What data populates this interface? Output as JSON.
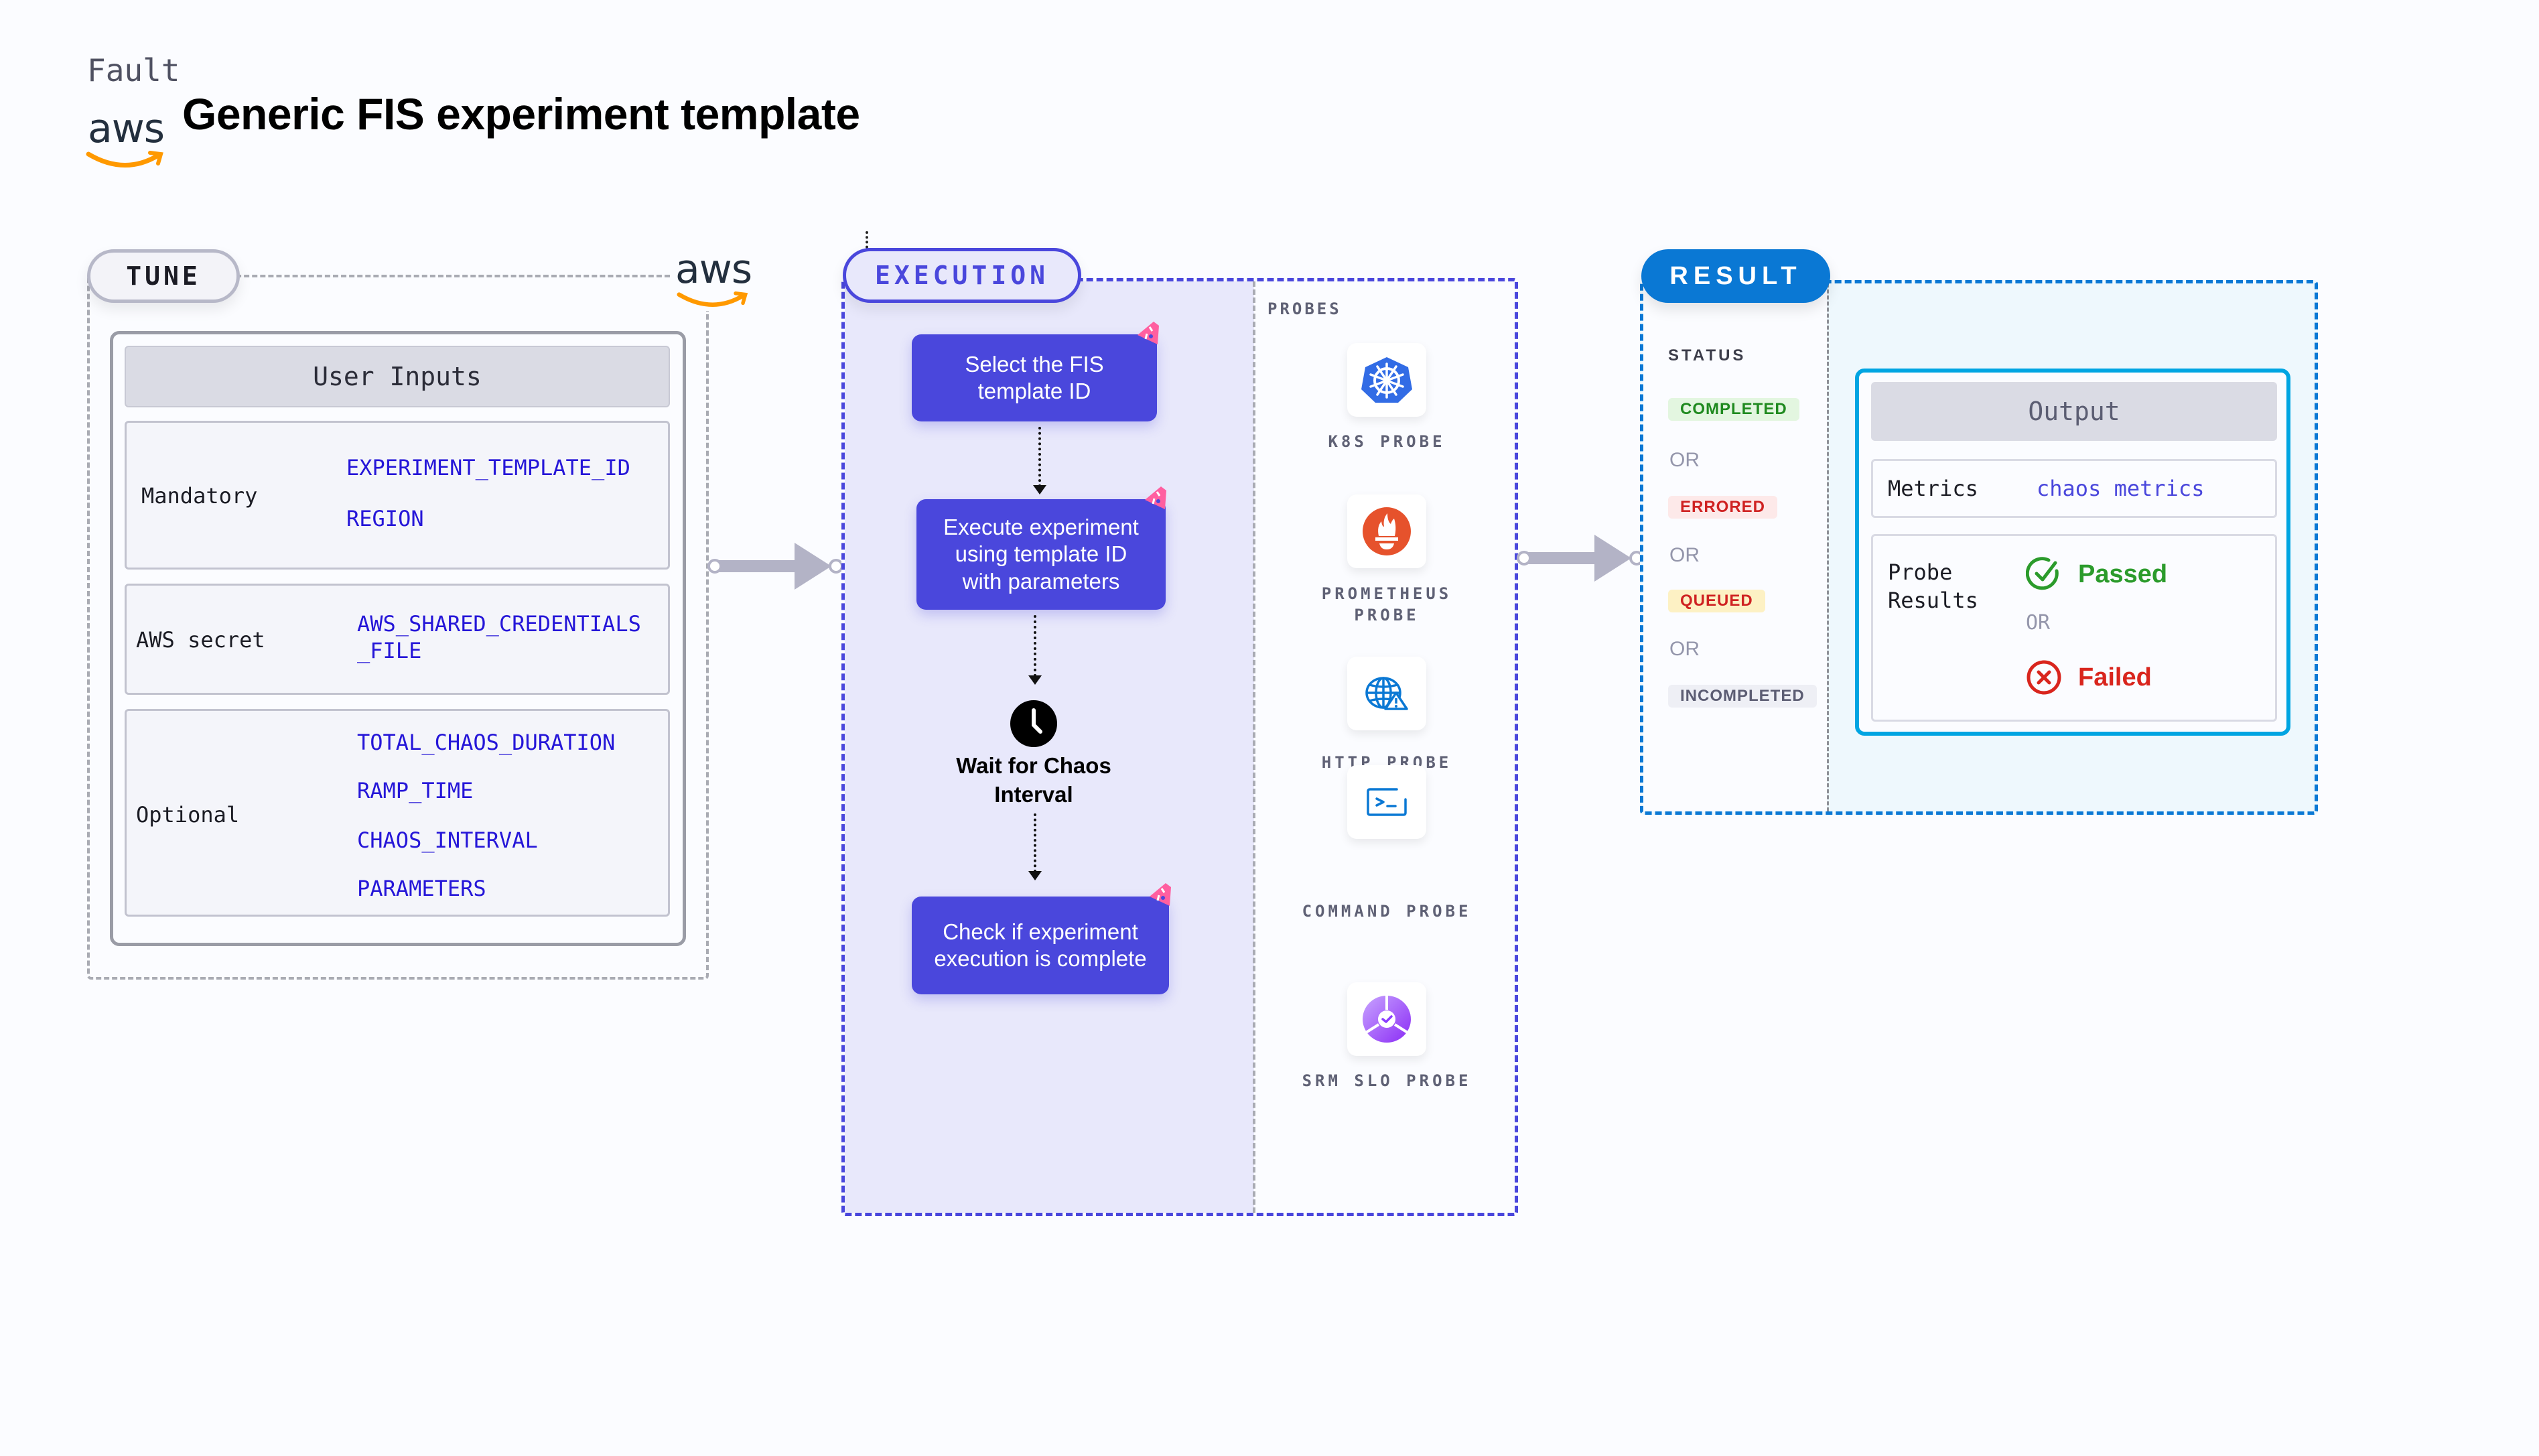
{
  "header": {
    "category": "Fault",
    "vendor_logo": "aws",
    "title": "Generic FIS experiment template"
  },
  "tune": {
    "label": "TUNE",
    "vendor_logo": "aws",
    "card_title": "User Inputs",
    "groups": [
      {
        "label": "Mandatory",
        "params": [
          "EXPERIMENT_TEMPLATE_ID",
          "REGION"
        ]
      },
      {
        "label": "AWS secret",
        "params": [
          "AWS_SHARED_CREDENTIALS",
          "_FILE"
        ]
      },
      {
        "label": "Optional",
        "params": [
          "TOTAL_CHAOS_DURATION",
          "RAMP_TIME",
          "CHAOS_INTERVAL",
          "PARAMETERS"
        ]
      }
    ]
  },
  "execution": {
    "label": "EXECUTION",
    "steps": [
      {
        "text": "Select the FIS template ID",
        "icon": "chaos-step-icon"
      },
      {
        "text": "Execute experiment using template ID with parameters",
        "icon": "chaos-step-icon"
      },
      {
        "text": "Wait for Chaos Interval",
        "icon": "clock-icon"
      },
      {
        "text": "Check if experiment execution is complete",
        "icon": "chaos-step-icon"
      }
    ],
    "probes_title": "PROBES",
    "probes": [
      {
        "label": "K8S PROBE",
        "icon": "kubernetes-icon",
        "color": "#326ce5"
      },
      {
        "label": "PROMETHEUS PROBE",
        "icon": "prometheus-icon",
        "color": "#e6522c"
      },
      {
        "label": "HTTP PROBE",
        "icon": "globe-warning-icon",
        "color": "#0a78d4"
      },
      {
        "label": "COMMAND PROBE",
        "icon": "terminal-icon",
        "color": "#0a78d4"
      },
      {
        "label": "SRM SLO PROBE",
        "icon": "slo-icon",
        "color": "#8b3dff"
      }
    ]
  },
  "result": {
    "label": "RESULT",
    "status_title": "STATUS",
    "statuses": [
      {
        "label": "COMPLETED",
        "fg": "#1f8a1f",
        "bg": "#e3f6e0"
      },
      {
        "label": "ERRORED",
        "fg": "#cf2222",
        "bg": "#fde9e9"
      },
      {
        "label": "QUEUED",
        "fg": "#cf2222",
        "bg": "#fdf1c4"
      },
      {
        "label": "INCOMPLETED",
        "fg": "#5c5d73",
        "bg": "#eeeff5"
      }
    ],
    "or_text": "OR",
    "output": {
      "title": "Output",
      "metrics_label": "Metrics",
      "metrics_value": "chaos metrics",
      "probe_results_label": "Probe Results",
      "passed": "Passed",
      "failed": "Failed",
      "passed_color": "#2b9b2b",
      "failed_color": "#d9251d"
    }
  }
}
